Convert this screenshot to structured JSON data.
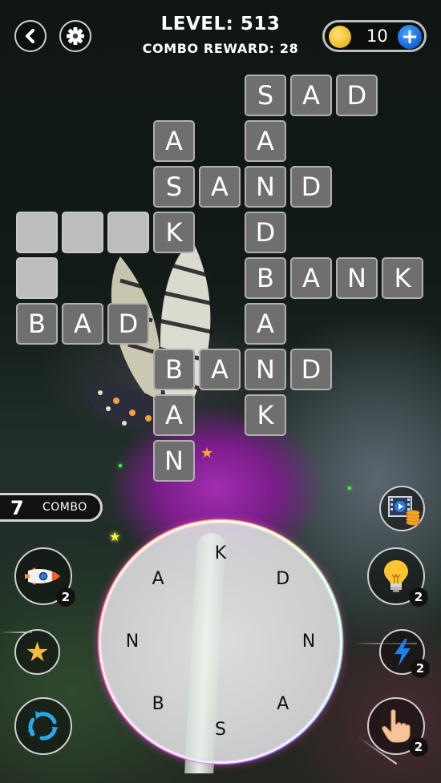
{
  "header": {
    "level_text": "LEVEL: 513",
    "combo_reward_text": "COMBO REWARD: 28",
    "coins": "10",
    "back_icon": "chevron-left-icon",
    "settings_icon": "gear-icon",
    "coin_icon": "coin-icon",
    "add_coins_icon": "plus-icon"
  },
  "grid": {
    "tiles": [
      {
        "row": 0,
        "col": 5,
        "letter": "S"
      },
      {
        "row": 0,
        "col": 6,
        "letter": "A"
      },
      {
        "row": 0,
        "col": 7,
        "letter": "D"
      },
      {
        "row": 1,
        "col": 3,
        "letter": "A"
      },
      {
        "row": 1,
        "col": 5,
        "letter": "A"
      },
      {
        "row": 2,
        "col": 3,
        "letter": "S"
      },
      {
        "row": 2,
        "col": 4,
        "letter": "A"
      },
      {
        "row": 2,
        "col": 5,
        "letter": "N"
      },
      {
        "row": 2,
        "col": 6,
        "letter": "D"
      },
      {
        "row": 3,
        "col": 0,
        "letter": ""
      },
      {
        "row": 3,
        "col": 1,
        "letter": ""
      },
      {
        "row": 3,
        "col": 2,
        "letter": ""
      },
      {
        "row": 3,
        "col": 3,
        "letter": "K"
      },
      {
        "row": 3,
        "col": 5,
        "letter": "D"
      },
      {
        "row": 4,
        "col": 0,
        "letter": ""
      },
      {
        "row": 4,
        "col": 5,
        "letter": "B"
      },
      {
        "row": 4,
        "col": 6,
        "letter": "A"
      },
      {
        "row": 4,
        "col": 7,
        "letter": "N"
      },
      {
        "row": 4,
        "col": 8,
        "letter": "K"
      },
      {
        "row": 5,
        "col": 0,
        "letter": "B"
      },
      {
        "row": 5,
        "col": 1,
        "letter": "A"
      },
      {
        "row": 5,
        "col": 2,
        "letter": "D"
      },
      {
        "row": 5,
        "col": 5,
        "letter": "A"
      },
      {
        "row": 6,
        "col": 3,
        "letter": "B"
      },
      {
        "row": 6,
        "col": 4,
        "letter": "A"
      },
      {
        "row": 6,
        "col": 5,
        "letter": "N"
      },
      {
        "row": 6,
        "col": 6,
        "letter": "D"
      },
      {
        "row": 7,
        "col": 3,
        "letter": "A"
      },
      {
        "row": 7,
        "col": 5,
        "letter": "K"
      },
      {
        "row": 8,
        "col": 3,
        "letter": "N"
      }
    ],
    "solved_words": [
      "SAD",
      "ASK",
      "SAND",
      "SANDBANK",
      "BANK",
      "BAD",
      "BAND",
      "BAN"
    ]
  },
  "combo": {
    "count": "7",
    "label": "COMBO"
  },
  "powerups": {
    "rocket": {
      "icon": "rocket-icon",
      "count": "2"
    },
    "star": {
      "icon": "star-icon"
    },
    "shuffle": {
      "icon": "shuffle-icon"
    },
    "video": {
      "icon": "video-coins-icon"
    },
    "hint": {
      "icon": "lightbulb-icon",
      "count": "2"
    },
    "lightning": {
      "icon": "lightning-icon",
      "count": "2"
    },
    "finger": {
      "icon": "pointing-finger-icon",
      "count": "2"
    }
  },
  "wheel": {
    "letters": [
      "K",
      "D",
      "N",
      "A",
      "S",
      "B",
      "N",
      "A"
    ]
  },
  "colors": {
    "tile_solved": "#6f6f6f",
    "tile_empty": "#bdbdbd",
    "tile_border": "#b0b0b0",
    "coin_gold": "#f4c233",
    "plus_blue": "#1266d6",
    "flower_magenta": "#a22db0"
  }
}
